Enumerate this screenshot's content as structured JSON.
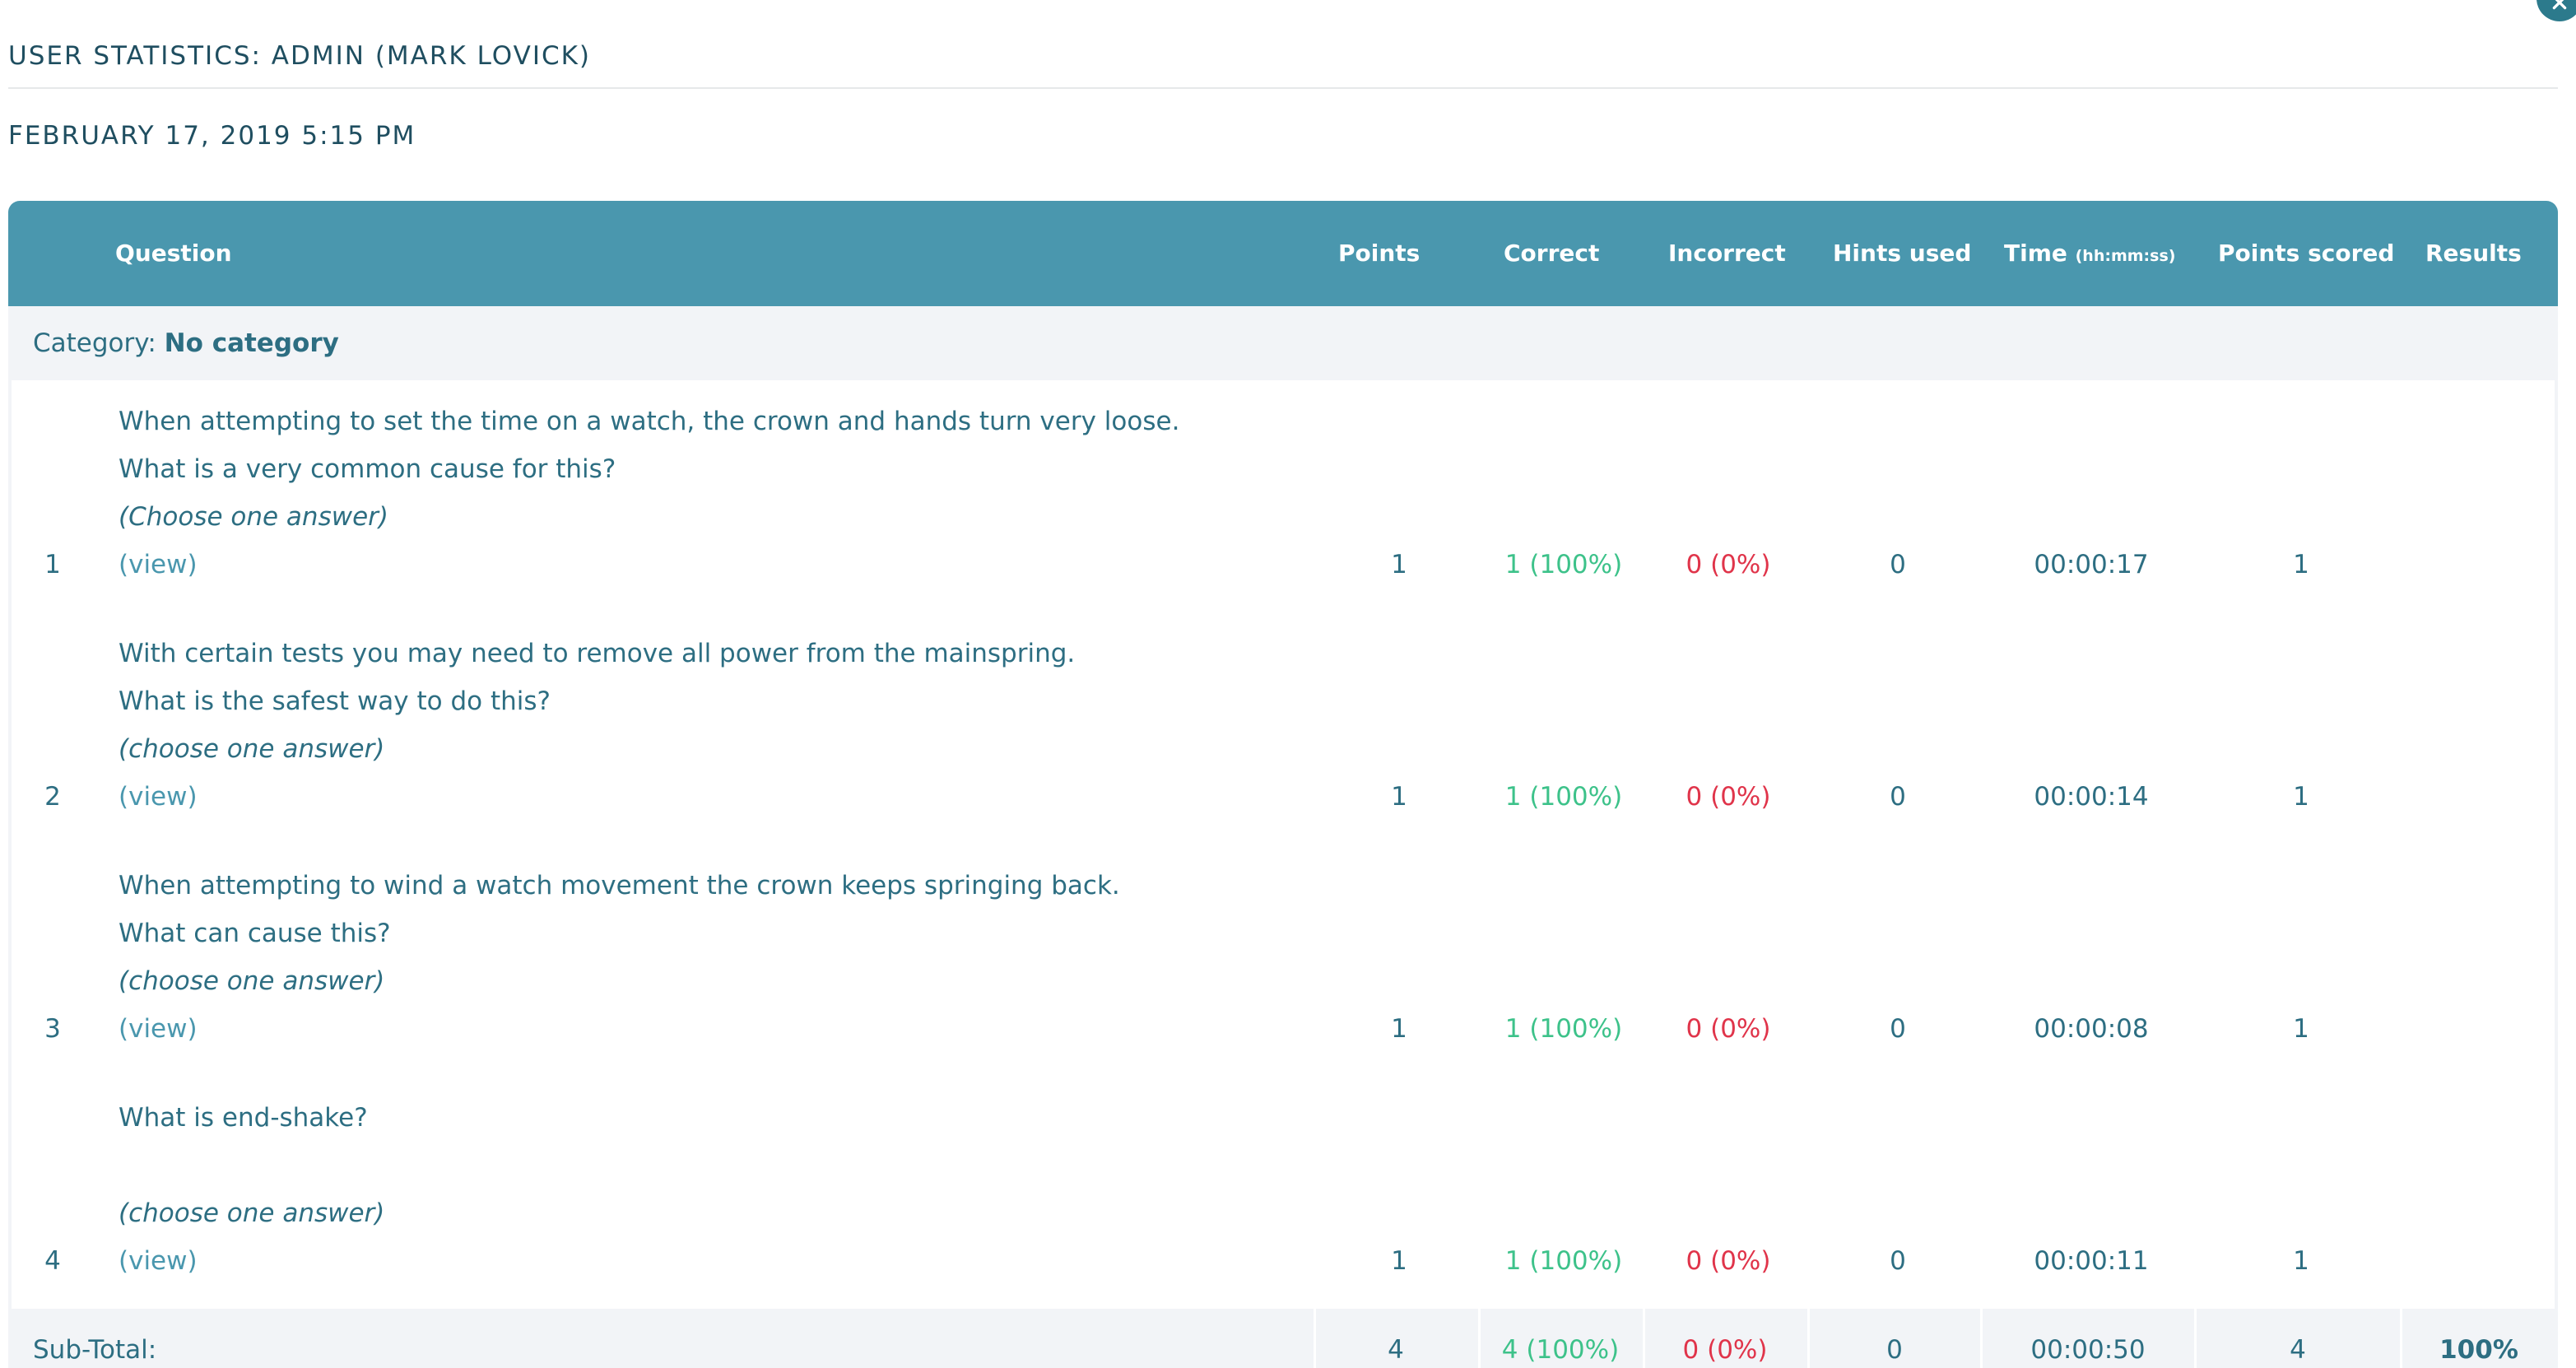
{
  "header": {
    "title": "USER STATISTICS: ADMIN (MARK LOVICK)",
    "date": "FEBRUARY 17, 2019 5:15 PM",
    "close_icon": "close-icon"
  },
  "table": {
    "columns": {
      "question": "Question",
      "points": "Points",
      "correct": "Correct",
      "incorrect": "Incorrect",
      "hints_used": "Hints used",
      "time": "Time",
      "time_unit": "(hh:mm:ss)",
      "points_scored": "Points scored",
      "results": "Results"
    },
    "category_label": "Category:",
    "category_name": "No category",
    "rows": [
      {
        "num": "1",
        "lines": [
          "When attempting to set the time on a watch, the crown and hands turn very loose.",
          "What is a very common cause for this?"
        ],
        "hint": "(Choose one answer)",
        "view": "(view)",
        "points": "1",
        "correct": "1 (100%)",
        "incorrect": "0 (0%)",
        "hints_used": "0",
        "time": "00:00:17",
        "points_scored": "1"
      },
      {
        "num": "2",
        "lines": [
          "With certain tests you may need to remove all power from the mainspring.",
          "What is the safest way to do this?"
        ],
        "hint": "(choose one answer)",
        "view": "(view)",
        "points": "1",
        "correct": "1 (100%)",
        "incorrect": "0 (0%)",
        "hints_used": "0",
        "time": "00:00:14",
        "points_scored": "1"
      },
      {
        "num": "3",
        "lines": [
          "When attempting to wind a watch movement the crown keeps springing back.",
          "What can cause this?"
        ],
        "hint": "(choose one answer)",
        "view": "(view)",
        "points": "1",
        "correct": "1 (100%)",
        "incorrect": "0 (0%)",
        "hints_used": "0",
        "time": "00:00:08",
        "points_scored": "1"
      },
      {
        "num": "4",
        "lines": [
          "What is end-shake?",
          ""
        ],
        "hint": "(choose one answer)",
        "view": "(view)",
        "points": "1",
        "correct": "1 (100%)",
        "incorrect": "0 (0%)",
        "hints_used": "0",
        "time": "00:00:11",
        "points_scored": "1"
      }
    ],
    "subtotal": {
      "label": "Sub-Total:",
      "points": "4",
      "correct": "4 (100%)",
      "incorrect": "0 (0%)",
      "hints_used": "0",
      "time": "00:00:50",
      "points_scored": "4",
      "results": "100%"
    }
  },
  "colors": {
    "header_bg": "#4a97ae",
    "text": "#2d6e82",
    "correct": "#3dc28a",
    "incorrect": "#e0344a",
    "stripe": "#f2f4f7"
  }
}
